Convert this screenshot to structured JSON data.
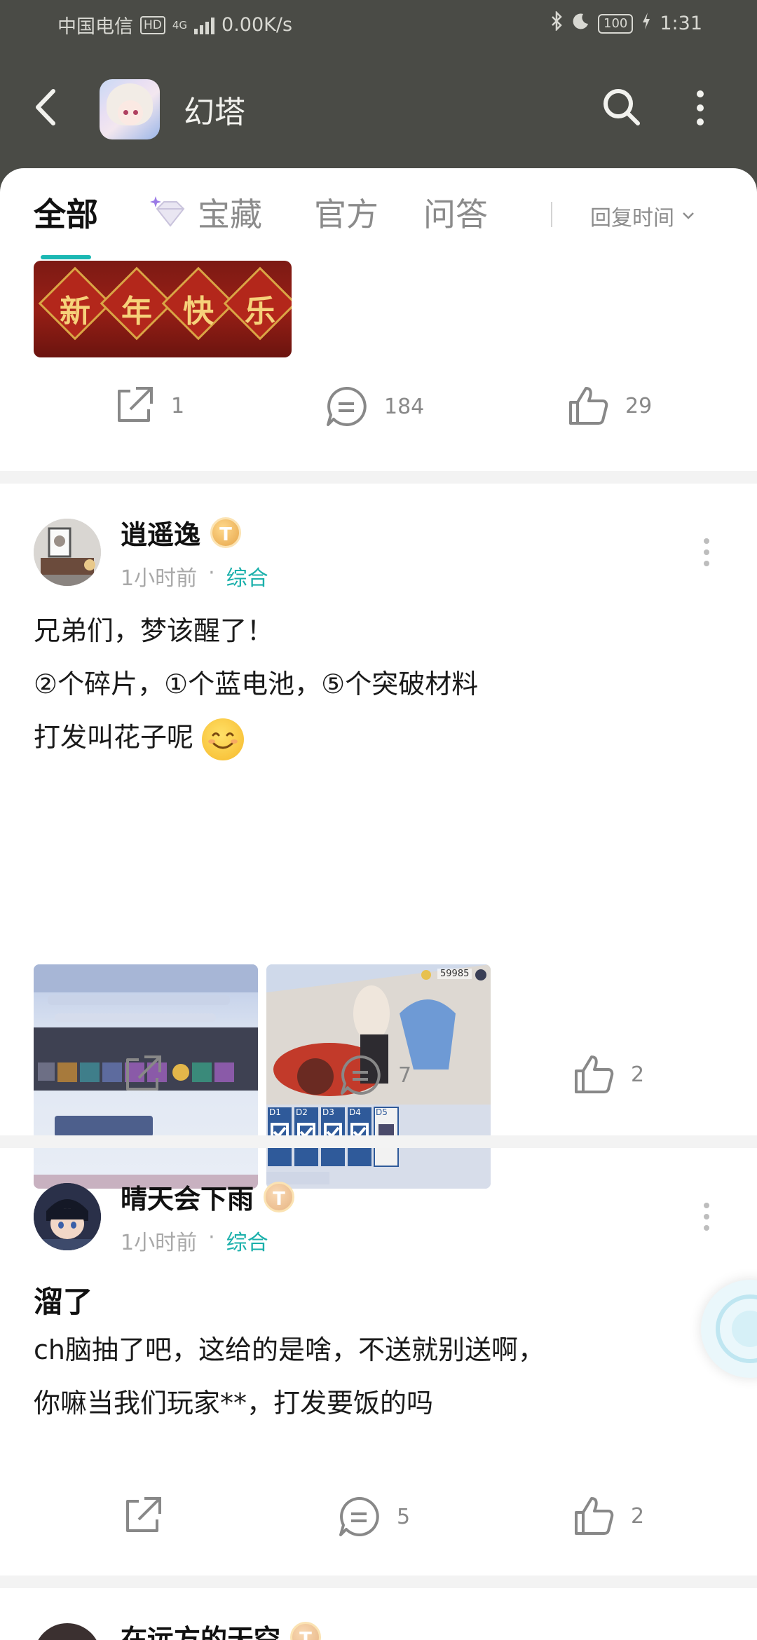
{
  "status_bar": {
    "carrier": "中国电信",
    "hd": "HD",
    "network": "4G",
    "speed": "0.00K/s",
    "battery": "100",
    "time": "1:31"
  },
  "app_bar": {
    "title": "幻塔"
  },
  "tabs": [
    {
      "label": "全部"
    },
    {
      "label": "宝藏"
    },
    {
      "label": "官方"
    },
    {
      "label": "问答"
    }
  ],
  "sort": {
    "label": "回复时间"
  },
  "prev_post": {
    "banner_text": [
      "新",
      "年",
      "快",
      "乐"
    ],
    "share_count": "1",
    "comment_count": "184",
    "like_count": "29"
  },
  "posts": [
    {
      "author": "逍遥逸",
      "level": "T",
      "time": "1小时前",
      "topic": "综合",
      "title": "",
      "body_lines": [
        "兄弟们，梦该醒了！",
        "②个碎片，①个蓝电池，⑤个突破材料",
        "打发叫花子呢"
      ],
      "share_count": "",
      "comment_count": "7",
      "like_count": "2",
      "image2_coins": "59985",
      "image2_days": [
        "D1",
        "D2",
        "D3",
        "D4",
        "D5"
      ]
    },
    {
      "author": "晴天会下雨",
      "level": "T",
      "time": "1小时前",
      "topic": "综合",
      "title": "溜了",
      "body_lines": [
        "ch脑抽了吧，这给的是啥，不送就别送啊，",
        "你嘛当我们玩家**，打发要饭的吗"
      ],
      "share_count": "",
      "comment_count": "5",
      "like_count": "2"
    },
    {
      "author": "在远方的天空",
      "level": "T"
    }
  ],
  "colors": {
    "accent": "#1bb8b3",
    "header_bg": "#4a4b46",
    "badge_gold": "#e6a54a"
  }
}
